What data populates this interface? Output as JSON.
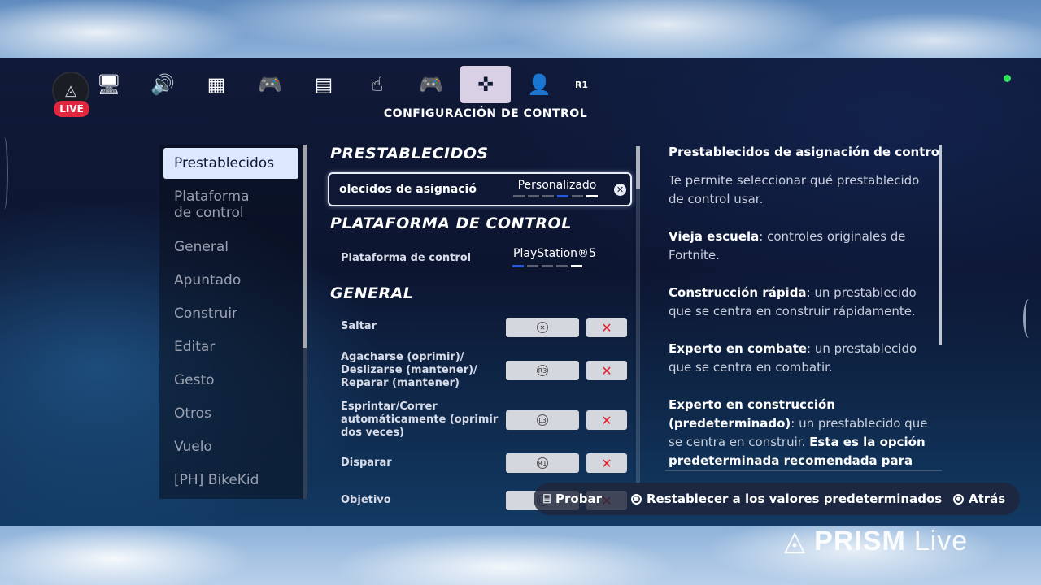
{
  "stream": {
    "live_badge": "LIVE",
    "watermark_brand": "PRISM",
    "watermark_suffix": "Live"
  },
  "nav": {
    "title": "CONFIGURACIÓN DE CONTROL",
    "tabs": [
      {
        "icon": "monitor-icon",
        "glyph": "🖥"
      },
      {
        "icon": "speaker-icon",
        "glyph": "🔊"
      },
      {
        "icon": "accessibility-grid-icon",
        "glyph": "▦"
      },
      {
        "icon": "gamepad-wrench-icon",
        "glyph": "🎮"
      },
      {
        "icon": "window-icon",
        "glyph": "▤"
      },
      {
        "icon": "touch-hand-icon",
        "glyph": "☝"
      },
      {
        "icon": "controller-icon",
        "glyph": "🎮"
      },
      {
        "icon": "dpad-controls-icon",
        "glyph": "✜",
        "active": true
      },
      {
        "icon": "account-icon",
        "glyph": "👤"
      },
      {
        "icon": "r1-button-icon",
        "glyph": "R1"
      }
    ]
  },
  "sidebar": {
    "items": [
      {
        "label": "Prestablecidos",
        "active": true
      },
      {
        "label": "Plataforma\nde control"
      },
      {
        "label": "General"
      },
      {
        "label": "Apuntado"
      },
      {
        "label": "Construir"
      },
      {
        "label": "Editar"
      },
      {
        "label": "Gesto"
      },
      {
        "label": "Otros"
      },
      {
        "label": "Vuelo"
      },
      {
        "label": "[PH] BikeKid"
      }
    ]
  },
  "settings": {
    "presets_heading": "PRESTABLECIDOS",
    "preset_row_label": "olecidos de asignación c",
    "preset_value": "Personalizado",
    "platform_heading": "PLATAFORMA DE CONTROL",
    "platform_row_label": "Plataforma de control",
    "platform_value": "PlayStation®5",
    "general_heading": "GENERAL",
    "bindings": [
      {
        "label": "Saltar",
        "button": "✕"
      },
      {
        "label": "Agacharse (oprimir)/ Deslizarse (mantener)/ Reparar (mantener)",
        "button": "R3"
      },
      {
        "label": "Esprintar/Correr automáticamente (oprimir dos veces)",
        "button": "L3"
      },
      {
        "label": "Disparar",
        "button": "R1"
      },
      {
        "label": "Objetivo",
        "button": "L1"
      }
    ]
  },
  "description": {
    "title": "Prestablecidos de asignación de control",
    "intro": "Te permite seleccionar qué prestablecido de control usar.",
    "items": [
      {
        "term": "Vieja escuela",
        "text": ": controles originales de Fortnite."
      },
      {
        "term": "Construcción rápida",
        "text": ": un prestablecido que se centra en construir rápidamente."
      },
      {
        "term": "Experto en combate",
        "text": ": un prestablecido que se centra en combatir."
      },
      {
        "term": "Experto en construcción (predeterminado)",
        "text": ": un prestablecido que se centra en construir. ",
        "extra": "Esta es la opción predeterminada recomendada para"
      }
    ]
  },
  "footer": {
    "test_label": "Probar",
    "reset_label": "Restablecer a los valores predeterminados",
    "back_label": "Atrás"
  },
  "colors": {
    "accent_active": "#d9d0e6",
    "sidebar_active": "#dbe8ff",
    "delete_red": "#e0212f",
    "live_red": "#e2263f",
    "status_green": "#2ee25a"
  }
}
